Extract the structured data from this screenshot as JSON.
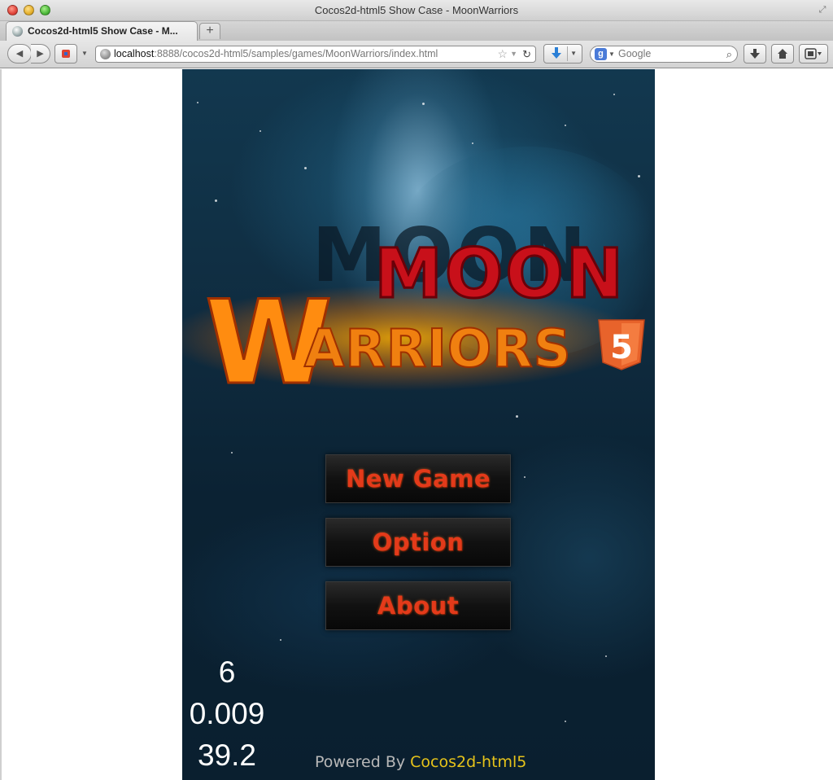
{
  "window": {
    "title": "Cocos2d-html5 Show Case - MoonWarriors"
  },
  "tabs": [
    {
      "label": "Cocos2d-html5 Show Case - M..."
    }
  ],
  "toolbar": {
    "url_host": "localhost",
    "url_path": ":8888/cocos2d-html5/samples/games/MoonWarriors/index.html",
    "search_placeholder": "Google"
  },
  "game": {
    "logo_line1": "MOON",
    "logo_line2": "WARRIORS",
    "logo_badge": "5",
    "menu": [
      {
        "label": "New Game"
      },
      {
        "label": "Option"
      },
      {
        "label": "About"
      }
    ],
    "stats": [
      "6",
      "0.009",
      "39.2"
    ],
    "footer_prefix": "Powered By",
    "footer_brand": "Cocos2d-html5"
  },
  "colors": {
    "menu_text": "#e33a1a",
    "logo_moon": "#c8101a",
    "logo_warriors": "#f08010",
    "html5_badge": "#e8632b",
    "footer_brand": "#e6c31a"
  }
}
